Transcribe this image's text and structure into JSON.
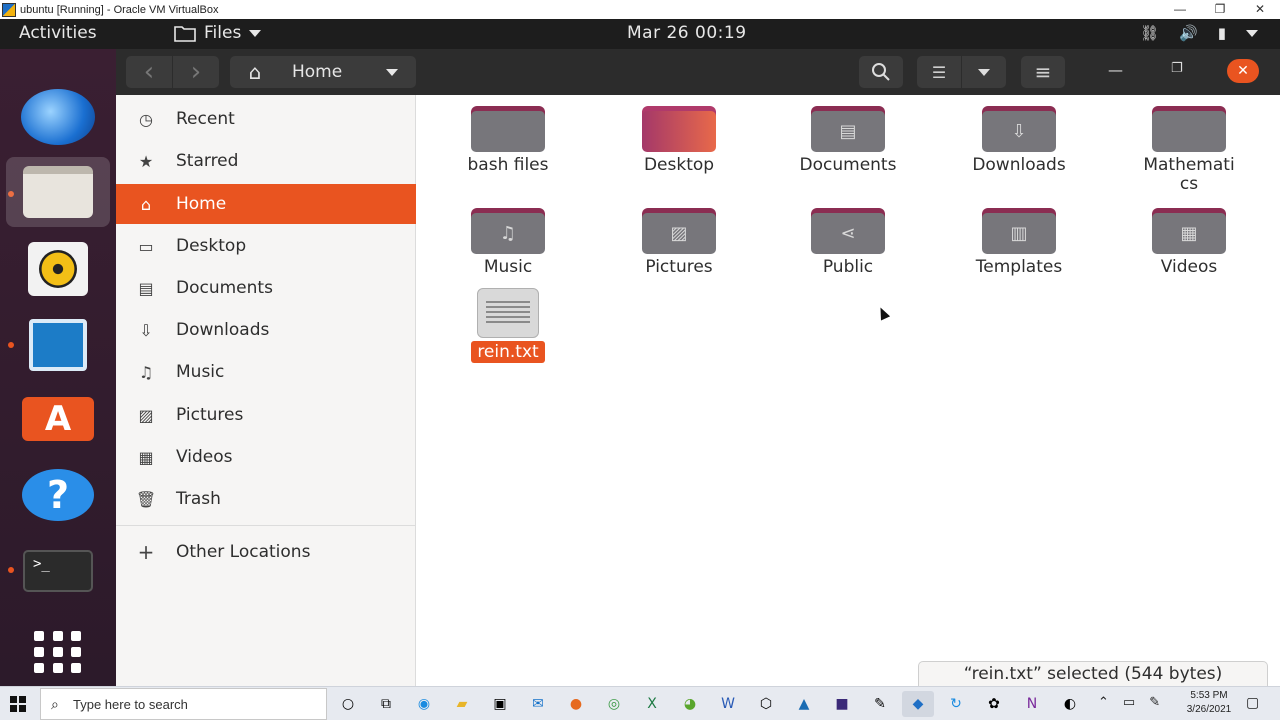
{
  "host_window": {
    "title": "ubuntu [Running] - Oracle VM VirtualBox",
    "controls": [
      "—",
      "❐",
      "✕"
    ]
  },
  "topbar": {
    "activities": "Activities",
    "app_menu": "Files",
    "clock": "Mar 26  00:19",
    "tray_icons": [
      "network-icon",
      "volume-icon",
      "battery-icon",
      "system-menu-icon"
    ]
  },
  "dock": {
    "items": [
      {
        "name": "thunderbird",
        "running": false
      },
      {
        "name": "files",
        "running": true
      },
      {
        "name": "rhythmbox",
        "running": false
      },
      {
        "name": "libreoffice-writer",
        "running": true
      },
      {
        "name": "ubuntu-software",
        "running": false
      },
      {
        "name": "help",
        "running": false
      },
      {
        "name": "terminal",
        "running": true
      },
      {
        "name": "show-applications",
        "running": false
      }
    ],
    "help_glyph": "?",
    "store_glyph": "A",
    "terminal_prompt": ">_"
  },
  "headerbar": {
    "back": "‹",
    "forward": "›",
    "location": "Home",
    "search_glyph": "⌕",
    "list_view_glyph": "☰",
    "menu_glyph": "≡",
    "minimize": "—",
    "restore": "❐",
    "close": "✕"
  },
  "sidebar": {
    "items": [
      {
        "label": "Recent",
        "icon": "clock-icon",
        "glyph": "◷",
        "active": false
      },
      {
        "label": "Starred",
        "icon": "star-icon",
        "glyph": "★",
        "active": false
      },
      {
        "label": "Home",
        "icon": "home-icon",
        "glyph": "⌂",
        "active": true
      },
      {
        "label": "Desktop",
        "icon": "desktop-icon",
        "glyph": "▭",
        "active": false
      },
      {
        "label": "Documents",
        "icon": "document-icon",
        "glyph": "▤",
        "active": false
      },
      {
        "label": "Downloads",
        "icon": "download-icon",
        "glyph": "⇩",
        "active": false
      },
      {
        "label": "Music",
        "icon": "music-icon",
        "glyph": "♫",
        "active": false
      },
      {
        "label": "Pictures",
        "icon": "picture-icon",
        "glyph": "▨",
        "active": false
      },
      {
        "label": "Videos",
        "icon": "video-icon",
        "glyph": "▦",
        "active": false
      },
      {
        "label": "Trash",
        "icon": "trash-icon",
        "glyph": "🗑",
        "active": false
      }
    ],
    "other_locations": {
      "label": "Other Locations",
      "glyph": "+"
    }
  },
  "files": [
    {
      "label": "bash files",
      "type": "folder",
      "emblem": ""
    },
    {
      "label": "Desktop",
      "type": "folder-desktop",
      "emblem": ""
    },
    {
      "label": "Documents",
      "type": "folder",
      "emblem": "▤"
    },
    {
      "label": "Downloads",
      "type": "folder",
      "emblem": "⇩"
    },
    {
      "label": "Mathemati\ncs",
      "type": "folder",
      "emblem": ""
    },
    {
      "label": "Music",
      "type": "folder",
      "emblem": "♫"
    },
    {
      "label": "Pictures",
      "type": "folder",
      "emblem": "▨"
    },
    {
      "label": "Public",
      "type": "folder",
      "emblem": "⋖"
    },
    {
      "label": "Templates",
      "type": "folder",
      "emblem": "▥"
    },
    {
      "label": "Videos",
      "type": "folder",
      "emblem": "▦"
    },
    {
      "label": "rein.txt",
      "type": "text-file",
      "selected": true
    }
  ],
  "status": "“rein.txt” selected  (544 bytes)",
  "taskbar": {
    "search_placeholder": "Type here to search",
    "clock_time": "5:53 PM",
    "clock_date": "3/26/2021"
  },
  "colors": {
    "accent": "#e95420",
    "folder_body": "#77767b",
    "folder_tab": "#8b2d52"
  }
}
